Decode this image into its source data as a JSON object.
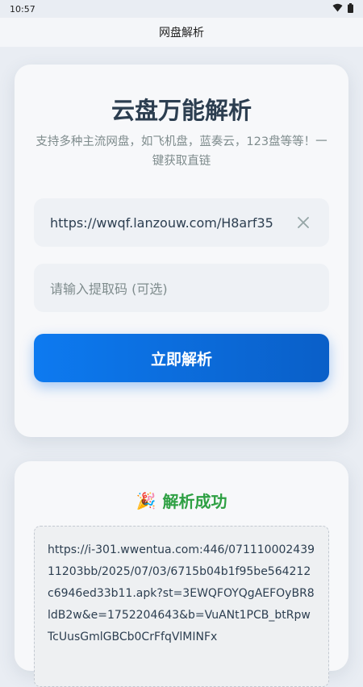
{
  "status_bar": {
    "time": "10:57",
    "wifi_icon": "wifi-icon",
    "battery_icon": "battery-icon"
  },
  "app_bar": {
    "title": "网盘解析"
  },
  "parser_card": {
    "title": "云盘万能解析",
    "subtitle": "支持多种主流网盘，如飞机盘，蓝奏云，123盘等等！一键获取直链",
    "url_input": {
      "value": "https://wwqf.lanzouw.com/H8arf35"
    },
    "code_input": {
      "placeholder": "请输入提取码 (可选)"
    },
    "parse_button": "立即解析"
  },
  "result_card": {
    "emoji": "🎉",
    "status": "解析成功",
    "link": "https://i-301.wwentua.com:446/07111000243911203bb/2025/07/03/6715b04b1f95be564212c6946ed33b11.apk?st=3EWQFOYQgAEFOyBR8ldB2w&e=1752204643&b=VuANt1PCB_btRpwTcUusGmlGBCb0CrFfqVlMINFx"
  },
  "colors": {
    "accent": "#0d7af0",
    "success": "#2ea043",
    "muted": "#7f8c8d",
    "text": "#2c3e50"
  }
}
